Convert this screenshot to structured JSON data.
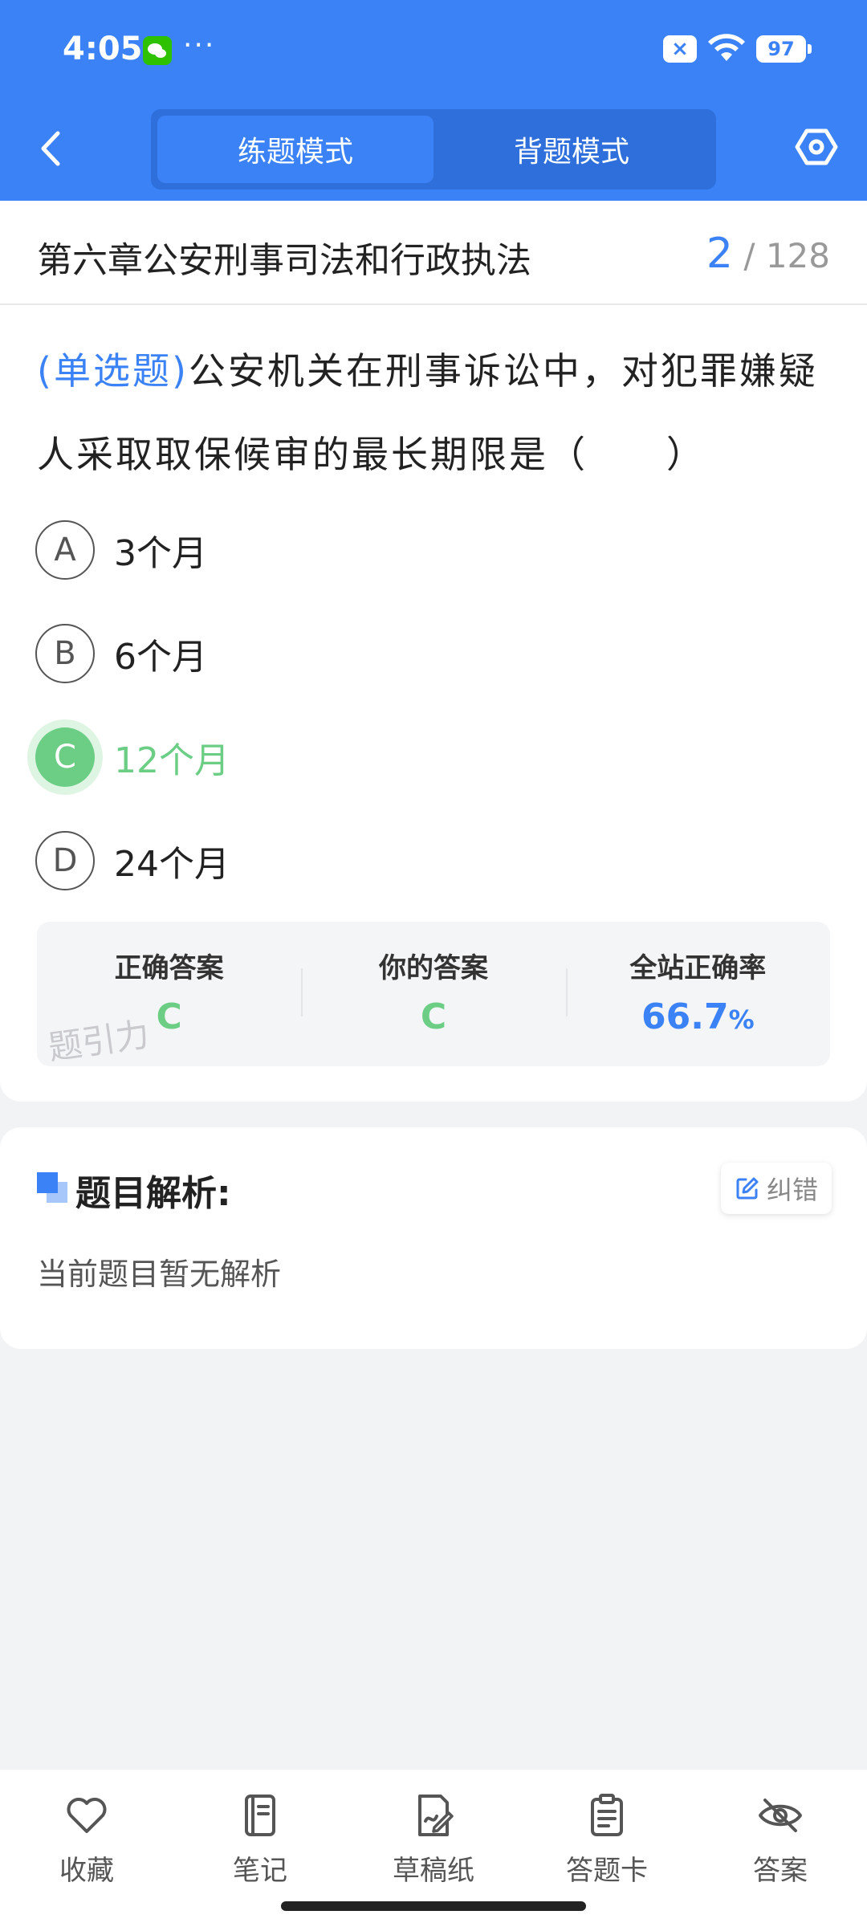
{
  "status_bar": {
    "time": "4:05",
    "dots": "···",
    "x_badge": "×",
    "battery": "97"
  },
  "header": {
    "modes": [
      "练题模式",
      "背题模式"
    ],
    "active_mode": "练题模式",
    "accent": "#3b82f6"
  },
  "chapter": {
    "title": "第六章公安刑事司法和行政执法",
    "current": "2",
    "separator": "/",
    "total": "128"
  },
  "question": {
    "type": "(单选题)",
    "text": "公安机关在刑事诉讼中，对犯罪嫌疑人采取取保候审的最长期限是（　　）",
    "options": [
      {
        "letter": "A",
        "text": "3个月"
      },
      {
        "letter": "B",
        "text": "6个月"
      },
      {
        "letter": "C",
        "text": "12个月"
      },
      {
        "letter": "D",
        "text": "24个月"
      }
    ],
    "selected": "C",
    "selected_color": "#6cce85"
  },
  "answer_panel": {
    "correct_label": "正确答案",
    "correct_value": "C",
    "yours_label": "你的答案",
    "yours_value": "C",
    "rate_label": "全站正确率",
    "rate_value": "66.7",
    "rate_unit": "%"
  },
  "watermark": "题引力",
  "analysis": {
    "title": "题目解析:",
    "correct_button": "纠错",
    "body": "当前题目暂无解析"
  },
  "bottom_nav": [
    {
      "label": "收藏",
      "icon": "heart-icon"
    },
    {
      "label": "笔记",
      "icon": "notebook-icon"
    },
    {
      "label": "草稿纸",
      "icon": "draft-paper-icon"
    },
    {
      "label": "答题卡",
      "icon": "answer-sheet-icon"
    },
    {
      "label": "答案",
      "icon": "eye-off-icon"
    }
  ]
}
